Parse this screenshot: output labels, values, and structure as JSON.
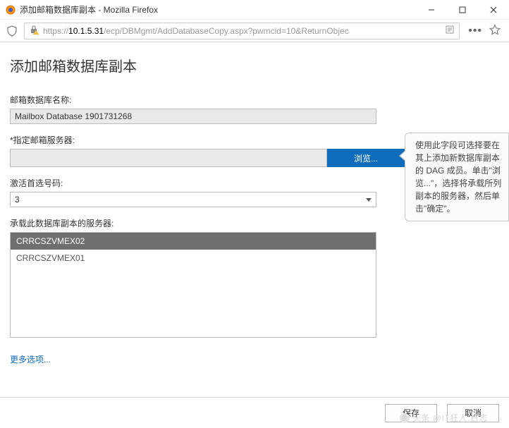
{
  "window": {
    "title": "添加邮箱数据库副本 - Mozilla Firefox"
  },
  "address": {
    "protocol": "https://",
    "host": "10.1.5.31",
    "path": "/ecp/DBMgmt/AddDatabaseCopy.aspx?pwmcid=10&ReturnObjec"
  },
  "page": {
    "heading": "添加邮箱数据库副本"
  },
  "labels": {
    "db_name": "邮箱数据库名称:",
    "server": "*指定邮箱服务器:",
    "activation": "激活首选号码:",
    "hosting_servers": "承载此数据库副本的服务器:"
  },
  "values": {
    "db_name": "Mailbox Database 1901731268",
    "server": "",
    "activation": "3"
  },
  "buttons": {
    "browse": "浏览...",
    "save": "保存",
    "cancel": "取消"
  },
  "server_list": [
    {
      "name": "CRRCSZVMEX02",
      "selected": true
    },
    {
      "name": "CRRCSZVMEX01",
      "selected": false
    }
  ],
  "links": {
    "more_options": "更多选项..."
  },
  "help": {
    "text": "使用此字段可选择要在其上添加新数据库副本的 DAG 成员。单击\"浏览...\"，选择将承载所列副本的服务器，然后单击\"确定\"。"
  },
  "watermark": {
    "text": "头条 @IT狂人.日志"
  }
}
